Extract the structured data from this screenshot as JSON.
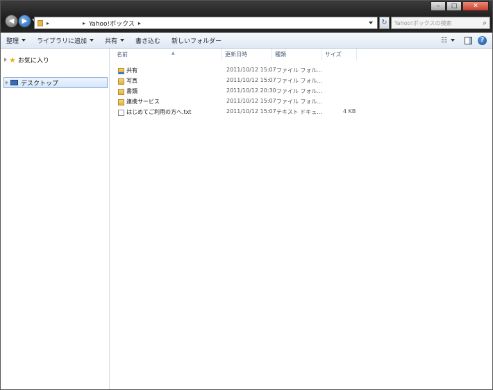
{
  "window": {
    "caption_buttons": [
      "–",
      "□",
      "✕"
    ]
  },
  "nav": {
    "back_glyph": "◀",
    "forward_glyph": "▶"
  },
  "address": {
    "path_visible": "Yahoo!ボックス",
    "separators": [
      "▸",
      "▸",
      "▸"
    ]
  },
  "search": {
    "placeholder": "Yahoo!ボックスの検索"
  },
  "toolbar": {
    "organize": "整理",
    "add_to_library": "ライブラリに追加",
    "share": "共有",
    "burn": "書き込む",
    "new_folder": "新しいフォルダー"
  },
  "navpane": {
    "favorites": "お気に入り",
    "desktop": "デスクトップ"
  },
  "columns": {
    "name": "名前",
    "date": "更新日時",
    "type": "種類",
    "size": "サイズ"
  },
  "files": [
    {
      "name": "共有",
      "date": "2011/10/12 15:07",
      "type": "ファイル フォル...",
      "size": "",
      "kind": "folder-shared"
    },
    {
      "name": "写真",
      "date": "2011/10/12 15:07",
      "type": "ファイル フォル...",
      "size": "",
      "kind": "folder"
    },
    {
      "name": "書類",
      "date": "2011/10/12 20:30",
      "type": "ファイル フォル...",
      "size": "",
      "kind": "folder"
    },
    {
      "name": "連携サービス",
      "date": "2011/10/12 15:07",
      "type": "ファイル フォル...",
      "size": "",
      "kind": "folder"
    },
    {
      "name": "はじめてご利用の方へ.txt",
      "date": "2011/10/12 15:07",
      "type": "テキスト ドキュ...",
      "size": "4 KB",
      "kind": "file"
    }
  ],
  "icons": {
    "search": "search-icon",
    "refresh": "refresh-icon",
    "help": "help-icon",
    "favorites": "star-icon",
    "desktop": "desktop-icon"
  }
}
